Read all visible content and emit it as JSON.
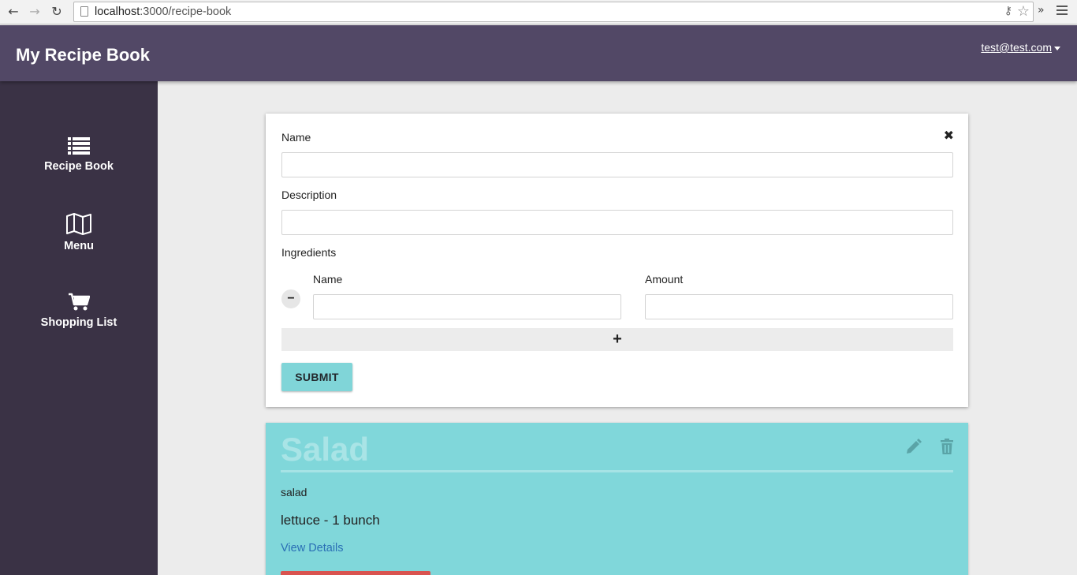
{
  "browser": {
    "url_host": "localhost",
    "url_path": ":3000/recipe-book"
  },
  "header": {
    "title": "My Recipe Book",
    "user_email": "test@test.com"
  },
  "sidebar": {
    "items": [
      {
        "label": "Recipe Book",
        "icon": "list-icon"
      },
      {
        "label": "Menu",
        "icon": "map-icon"
      },
      {
        "label": "Shopping List",
        "icon": "cart-icon"
      }
    ]
  },
  "form": {
    "name_label": "Name",
    "name_value": "",
    "description_label": "Description",
    "description_value": "",
    "ingredients_label": "Ingredients",
    "ingredient_name_label": "Name",
    "ingredient_amount_label": "Amount",
    "ingredient_name_value": "",
    "ingredient_amount_value": "",
    "remove_symbol": "−",
    "add_symbol": "+",
    "close_symbol": "✖",
    "submit_label": "SUBMIT"
  },
  "recipe": {
    "title": "Salad",
    "description": "salad",
    "ingredient": "lettuce - 1 bunch",
    "view_details": "View Details"
  },
  "colors": {
    "header_bg": "#524866",
    "sidebar_bg": "#3a3245",
    "accent": "#80d5d8",
    "recipe_card_bg": "#80d7da",
    "danger": "#d9534f",
    "link": "#2a6fb5"
  }
}
